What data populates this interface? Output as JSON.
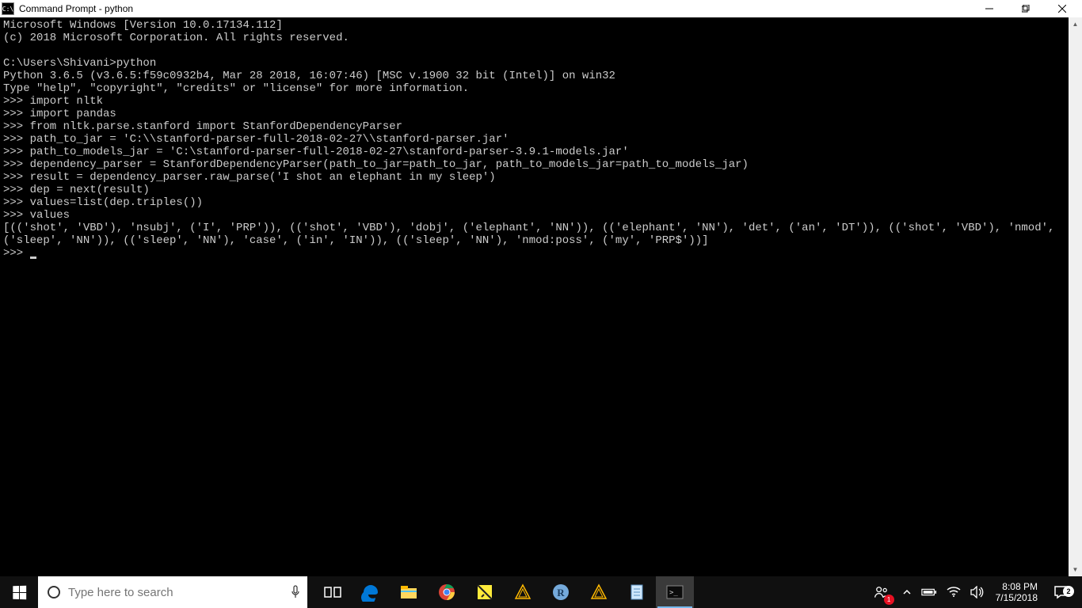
{
  "titlebar": {
    "icon_text": "C:\\",
    "title": "Command Prompt - python"
  },
  "terminal": {
    "lines": [
      "Microsoft Windows [Version 10.0.17134.112]",
      "(c) 2018 Microsoft Corporation. All rights reserved.",
      "",
      "C:\\Users\\Shivani>python",
      "Python 3.6.5 (v3.6.5:f59c0932b4, Mar 28 2018, 16:07:46) [MSC v.1900 32 bit (Intel)] on win32",
      "Type \"help\", \"copyright\", \"credits\" or \"license\" for more information.",
      ">>> import nltk",
      ">>> import pandas",
      ">>> from nltk.parse.stanford import StanfordDependencyParser",
      ">>> path_to_jar = 'C:\\\\stanford-parser-full-2018-02-27\\\\stanford-parser.jar'",
      ">>> path_to_models_jar = 'C:\\stanford-parser-full-2018-02-27\\stanford-parser-3.9.1-models.jar'",
      ">>> dependency_parser = StanfordDependencyParser(path_to_jar=path_to_jar, path_to_models_jar=path_to_models_jar)",
      ">>> result = dependency_parser.raw_parse('I shot an elephant in my sleep')",
      ">>> dep = next(result)",
      ">>> values=list(dep.triples())",
      ">>> values",
      "[(('shot', 'VBD'), 'nsubj', ('I', 'PRP')), (('shot', 'VBD'), 'dobj', ('elephant', 'NN')), (('elephant', 'NN'), 'det', ('an', 'DT')), (('shot', 'VBD'), 'nmod', ('sleep', 'NN')), (('sleep', 'NN'), 'case', ('in', 'IN')), (('sleep', 'NN'), 'nmod:poss', ('my', 'PRP$'))]"
    ],
    "prompt": ">>> "
  },
  "taskbar": {
    "search_placeholder": "Type here to search"
  },
  "tray": {
    "time": "8:08 PM",
    "date": "7/15/2018",
    "notif_count": "2",
    "people_count": "1"
  }
}
